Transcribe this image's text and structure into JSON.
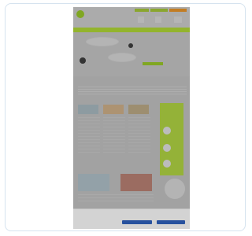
{
  "colors": {
    "accent": "#8fbf1d",
    "nav": "#a6cf2a",
    "cookie_button": "#2356b4",
    "card_border": "#d6e3ef"
  },
  "thumbnail": {
    "header": {
      "logo_icon": "leaf-logo-icon"
    },
    "hero": {
      "button_icon": "cta-button"
    },
    "cookie_banner": {}
  }
}
